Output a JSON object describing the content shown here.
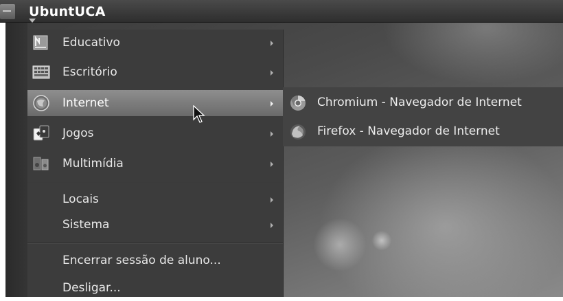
{
  "panel": {
    "app_menu_title": "UbuntUCA"
  },
  "menu": {
    "items": [
      {
        "label": "Educativo",
        "icon": "education-icon",
        "has_submenu": true
      },
      {
        "label": "Escritório",
        "icon": "office-icon",
        "has_submenu": true
      },
      {
        "label": "Internet",
        "icon": "internet-globe-icon",
        "has_submenu": true,
        "active": true
      },
      {
        "label": "Jogos",
        "icon": "games-cards-icon",
        "has_submenu": true
      },
      {
        "label": "Multimídia",
        "icon": "multimedia-icon",
        "has_submenu": true
      },
      {
        "label": "Locais",
        "has_submenu": true
      },
      {
        "label": "Sistema",
        "has_submenu": true
      },
      {
        "label": "Encerrar sessão de aluno..."
      },
      {
        "label": "Desligar..."
      }
    ]
  },
  "submenu": {
    "items": [
      {
        "label": "Chromium - Navegador de Internet",
        "icon": "chromium-icon"
      },
      {
        "label": "Firefox - Navegador de Internet",
        "icon": "firefox-icon"
      }
    ]
  },
  "colors": {
    "menu_bg": "#3c3c3c",
    "active_item": "#7c7c7c",
    "panel_bg": "#3a3a3a",
    "text": "#e8e8e8"
  }
}
